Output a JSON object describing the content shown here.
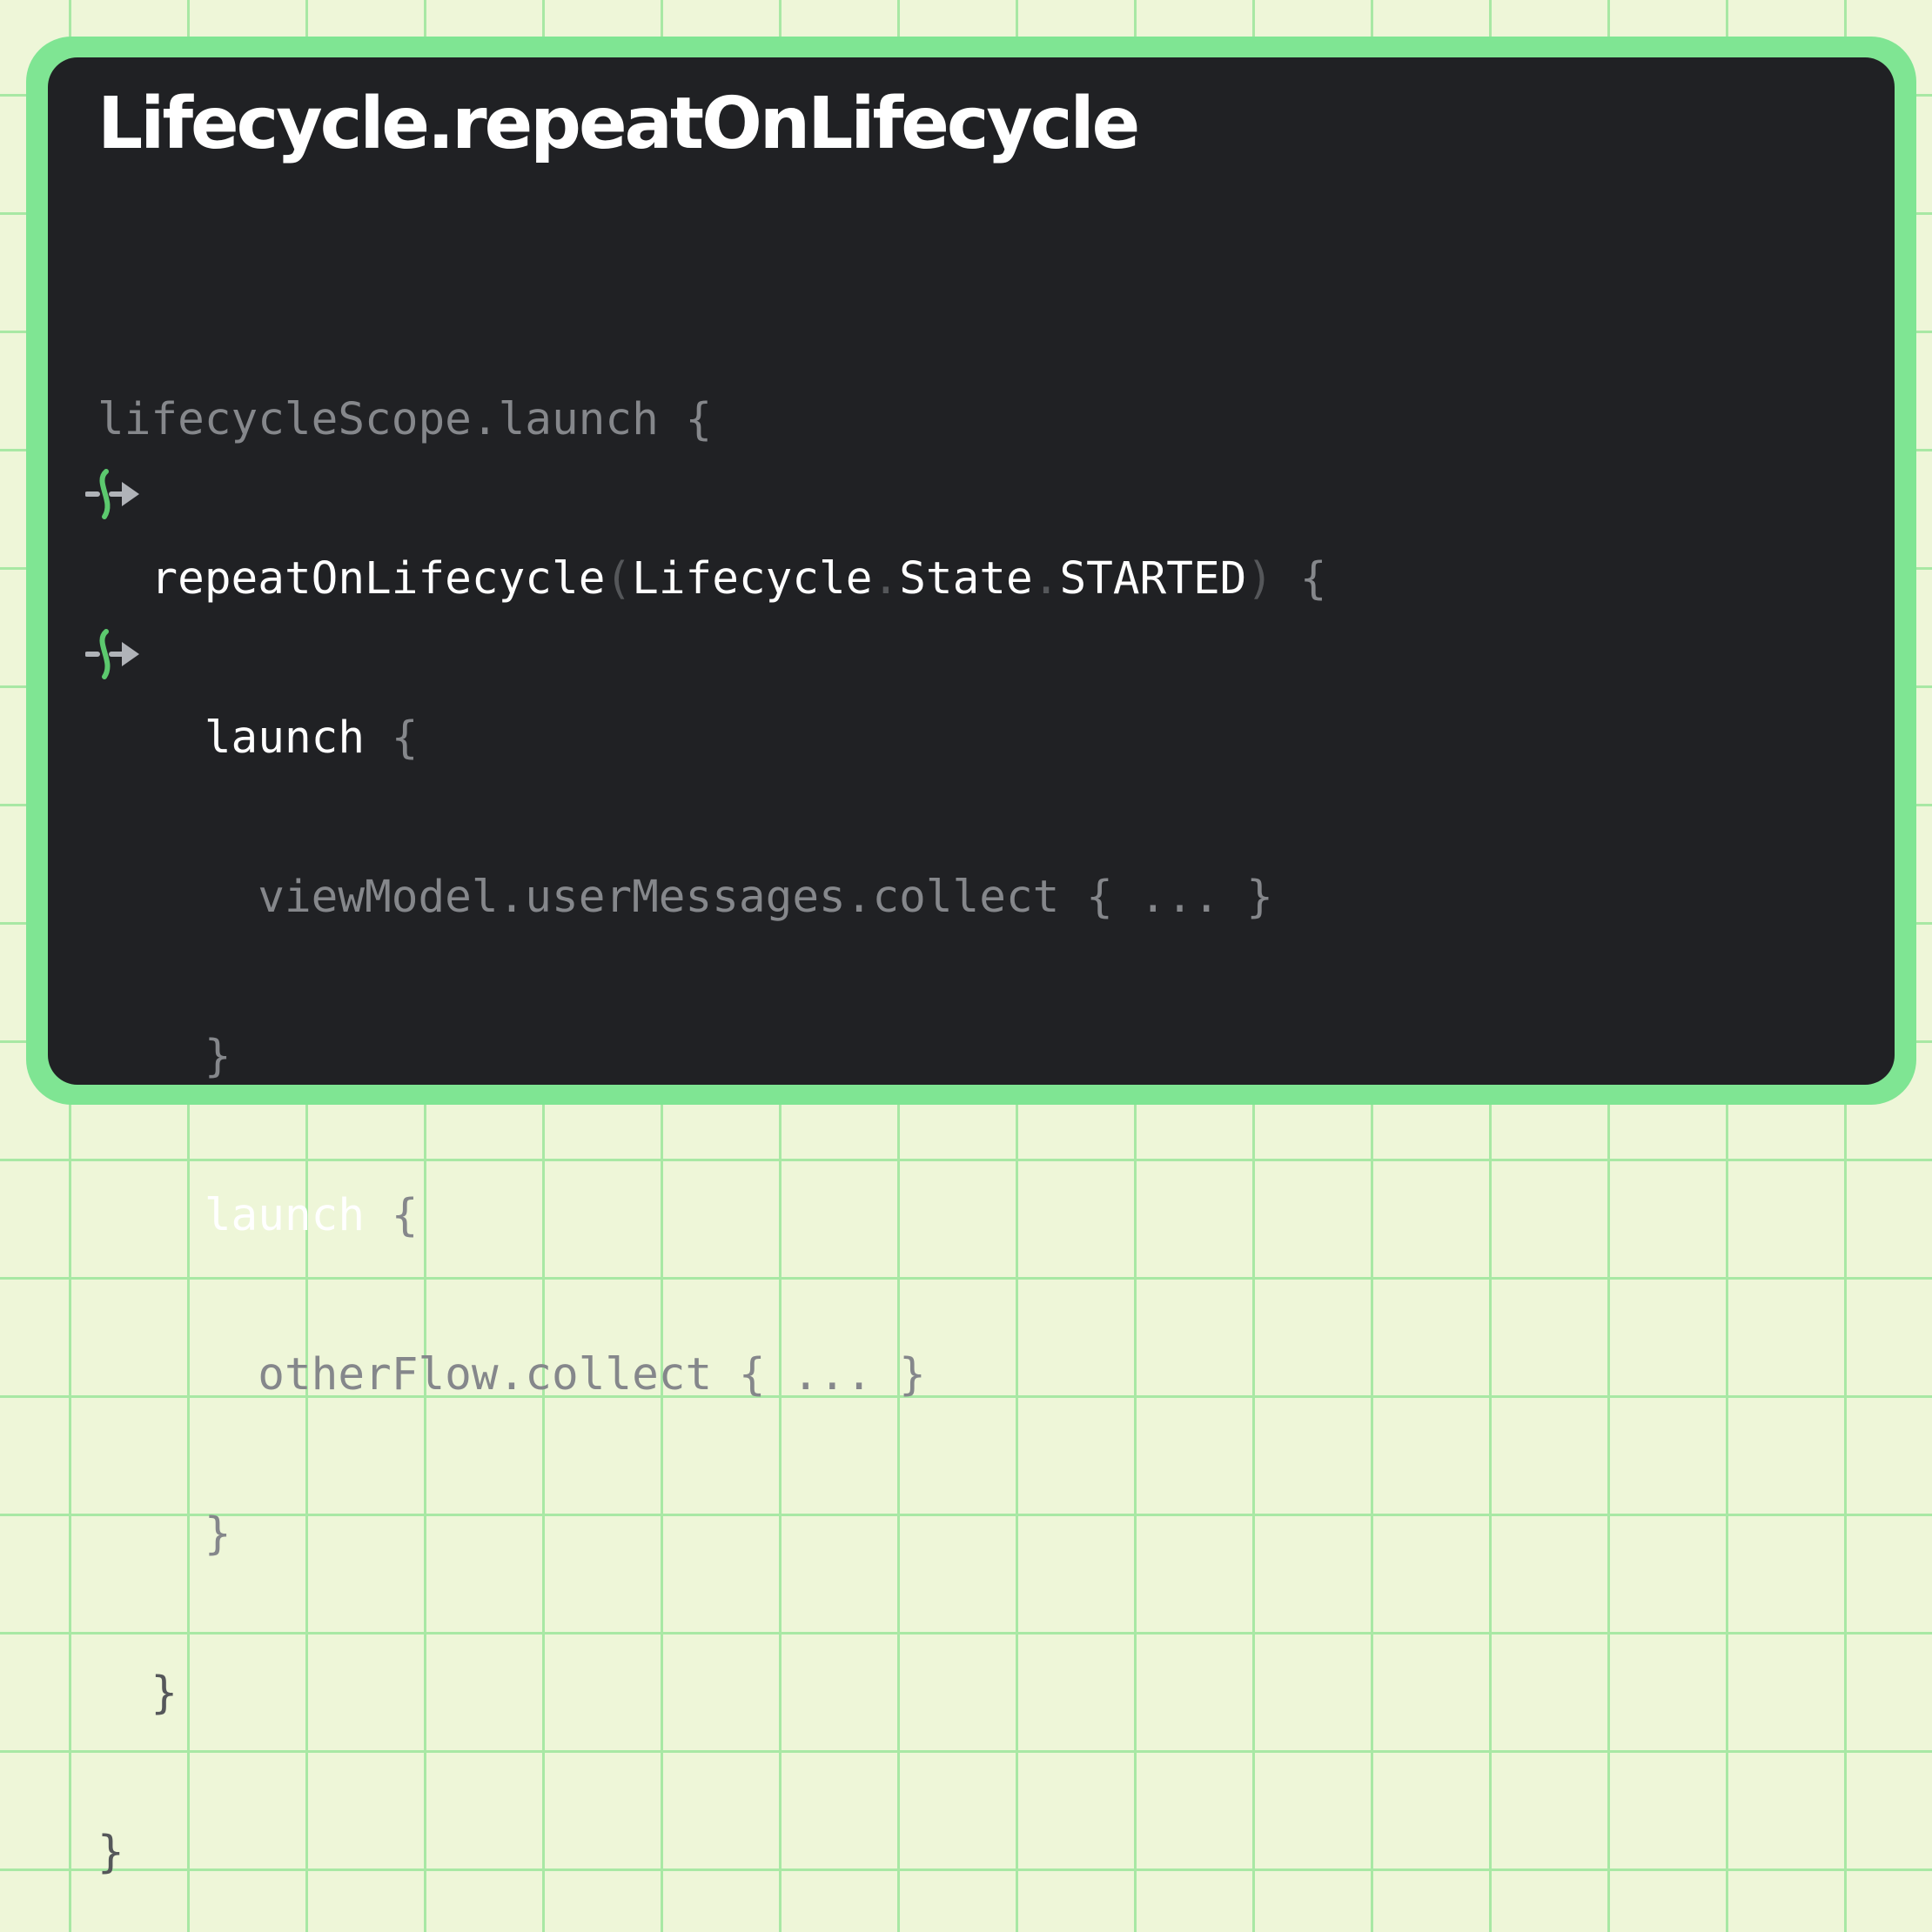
{
  "title": "Lifecycle.repeatOnLifecycle",
  "colors": {
    "background": "#eef6d8",
    "grid": "#a8e8a4",
    "frame": "#7fe593",
    "panel": "#202124",
    "text": "#ffffff",
    "text_muted": "#85878b",
    "text_dim": "#55575a",
    "icon_green": "#5cc96e",
    "icon_gray": "#b0b3b8"
  },
  "code": {
    "line1": {
      "text": "lifecycleScope.launch {"
    },
    "line2": {
      "indent": "  ",
      "name": "repeatOnLifecycle",
      "open_paren": "(",
      "lifecycle": "Lifecycle",
      "dot1": ".",
      "state": "State",
      "dot2": ".",
      "started": "STARTED",
      "close_paren": ")",
      "brace": " {"
    },
    "line3": {
      "indent": "    ",
      "text": "launch",
      "brace": " {"
    },
    "line4": {
      "indent": "      ",
      "text": "viewModel.userMessages.collect { ... }"
    },
    "line5": {
      "indent": "    ",
      "text": "}"
    },
    "line6": {
      "indent": "    ",
      "text": "launch",
      "brace": " {"
    },
    "line7": {
      "indent": "      ",
      "text": "otherFlow.collect { ... }"
    },
    "line8": {
      "indent": "    ",
      "text": "}"
    },
    "line9": {
      "indent": "  ",
      "text": "}"
    },
    "line10": {
      "text": "}"
    }
  },
  "icons": [
    "collect-flow-icon",
    "collect-flow-icon"
  ]
}
